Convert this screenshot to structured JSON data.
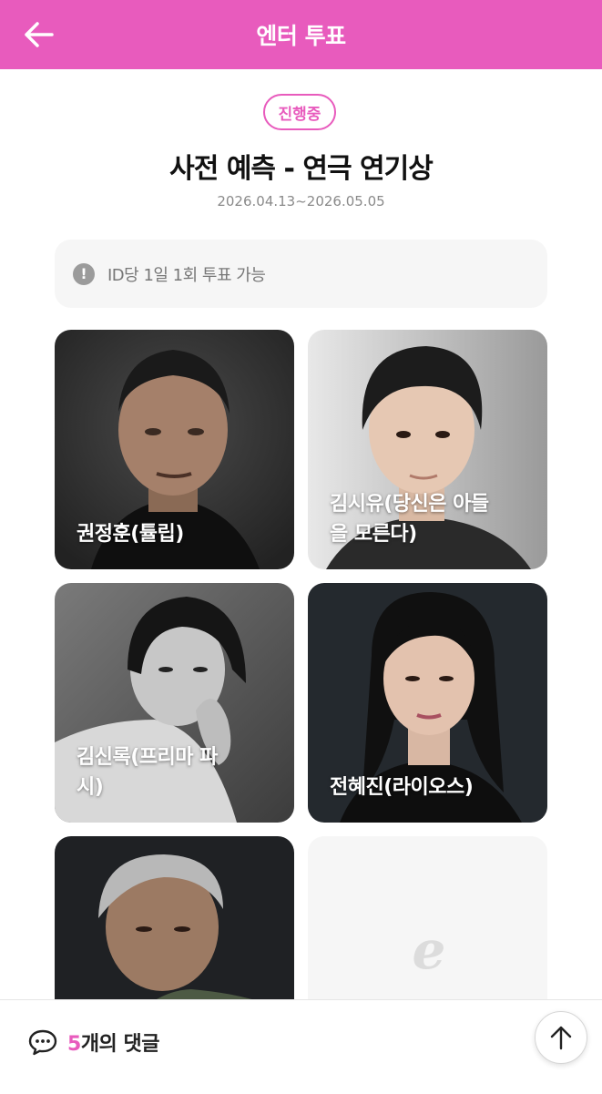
{
  "header": {
    "title": "엔터 투표",
    "back_icon": "arrow-left-icon"
  },
  "vote": {
    "status": "진행중",
    "title": "사전 예측 - 연극 연기상",
    "period": "2026.04.13~2026.05.05",
    "notice": "ID당 1일 1회 투표 가능"
  },
  "candidates": [
    {
      "name": "권정훈(튤립)"
    },
    {
      "name": "김시유(당신은 아들을 모른다)"
    },
    {
      "name": "김신록(프리마 파시)"
    },
    {
      "name": "전혜진(라이오스)"
    },
    {
      "name": ""
    }
  ],
  "placeholder": {
    "logo": "e"
  },
  "bottom": {
    "comment_count": "5",
    "comment_suffix": "개의 댓글",
    "scroll_top_icon": "arrow-up-icon"
  },
  "colors": {
    "accent": "#e85bbd",
    "notice_bg": "#f6f6f6"
  }
}
